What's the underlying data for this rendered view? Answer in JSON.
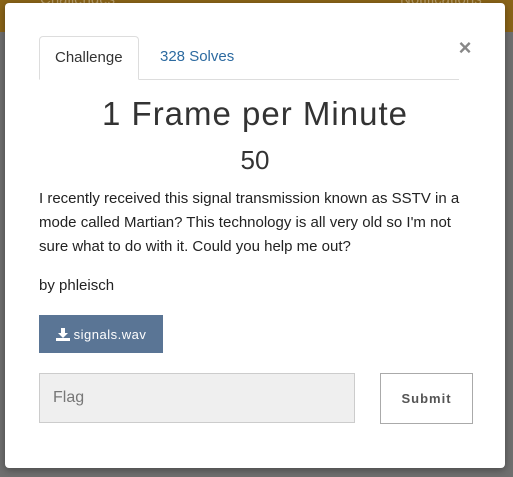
{
  "background": {
    "nav_left": "Challenges",
    "nav_right": "Notifications"
  },
  "modal": {
    "tabs": [
      {
        "label": "Challenge",
        "active": true
      },
      {
        "label": "328 Solves",
        "active": false
      }
    ],
    "close_label": "×",
    "title": "1 Frame per Minute",
    "value": "50",
    "description": "I recently received this signal transmission known as SSTV in a mode called Martian? This technology is all very old so I'm not sure what to do with it. Could you help me out?",
    "author": "by phleisch",
    "file": {
      "label": "signals.wav",
      "icon": "download-icon"
    },
    "flag_input": {
      "placeholder": "Flag",
      "value": ""
    },
    "submit_label": "Submit"
  },
  "colors": {
    "header_bar": "#8a6418",
    "file_button": "#5a7595",
    "tab_link": "#2c6aa0",
    "overlay": "#6f6f6f"
  }
}
